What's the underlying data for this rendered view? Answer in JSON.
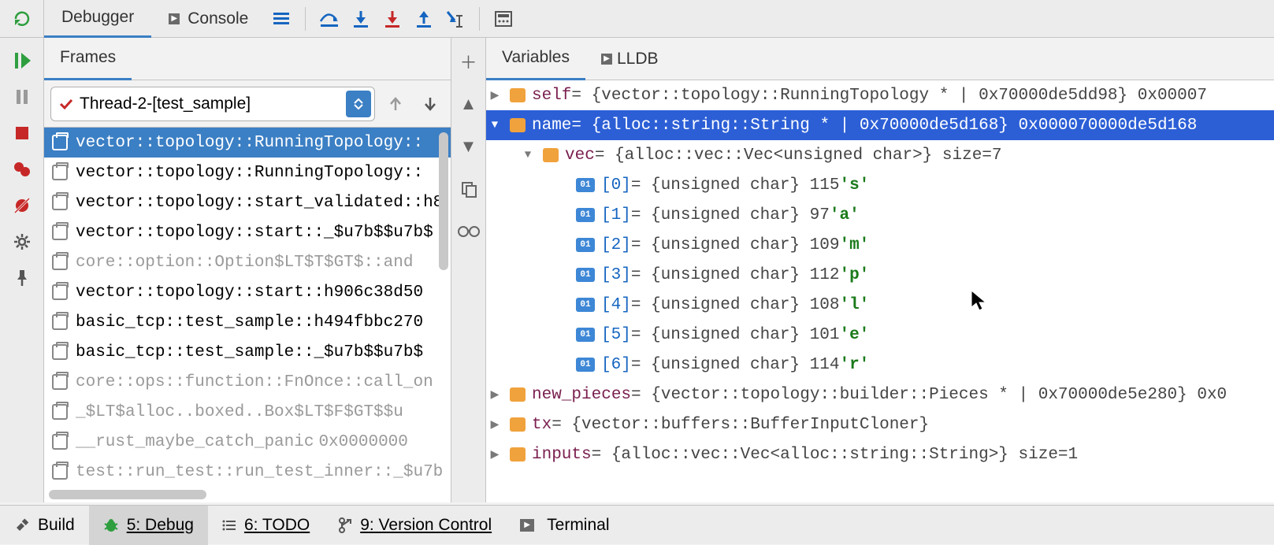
{
  "toolbar": {
    "tabs": {
      "debugger": "Debugger",
      "console": "Console"
    }
  },
  "frames": {
    "panel_label": "Frames",
    "thread": "Thread-2-[test_sample]",
    "items": [
      {
        "label": "vector::topology::RunningTopology::",
        "dim": false,
        "selected": true
      },
      {
        "label": "vector::topology::RunningTopology::",
        "dim": false
      },
      {
        "label": "vector::topology::start_validated::h8",
        "dim": false
      },
      {
        "label": "vector::topology::start::_$u7b$$u7b$",
        "dim": false
      },
      {
        "label": "core::option::Option$LT$T$GT$::and",
        "dim": true
      },
      {
        "label": "vector::topology::start::h906c38d50",
        "dim": false
      },
      {
        "label": "basic_tcp::test_sample::h494fbbc270",
        "dim": false
      },
      {
        "label": "basic_tcp::test_sample::_$u7b$$u7b$",
        "dim": false
      },
      {
        "label": "core::ops::function::FnOnce::call_on",
        "dim": true
      },
      {
        "label": "_$LT$alloc..boxed..Box$LT$F$GT$$u",
        "dim": true
      },
      {
        "label": "__rust_maybe_catch_panic",
        "dim": true,
        "hex": "0x0000000"
      },
      {
        "label": "test::run_test::run_test_inner::_$u7b",
        "dim": true
      }
    ]
  },
  "vars": {
    "tabs": {
      "variables": "Variables",
      "lldb": "LLDB"
    },
    "rows": [
      {
        "indent": 0,
        "twisty": "right",
        "kind": "struct",
        "name": "self",
        "value": " = {vector::topology::RunningTopology * | 0x70000de5dd98} 0x00007"
      },
      {
        "indent": 0,
        "twisty": "down",
        "kind": "struct",
        "name": "name",
        "value": " = {alloc::string::String * | 0x70000de5d168} 0x000070000de5d168",
        "selected": true
      },
      {
        "indent": 1,
        "twisty": "down",
        "kind": "struct",
        "name": "vec",
        "value": " = {alloc::vec::Vec<unsigned char>} size=7"
      },
      {
        "indent": 2,
        "twisty": "",
        "kind": "prim",
        "idx": "[0]",
        "value": " = {unsigned char} 115 ",
        "char": "'s'"
      },
      {
        "indent": 2,
        "twisty": "",
        "kind": "prim",
        "idx": "[1]",
        "value": " = {unsigned char} 97 ",
        "char": "'a'"
      },
      {
        "indent": 2,
        "twisty": "",
        "kind": "prim",
        "idx": "[2]",
        "value": " = {unsigned char} 109 ",
        "char": "'m'"
      },
      {
        "indent": 2,
        "twisty": "",
        "kind": "prim",
        "idx": "[3]",
        "value": " = {unsigned char} 112 ",
        "char": "'p'"
      },
      {
        "indent": 2,
        "twisty": "",
        "kind": "prim",
        "idx": "[4]",
        "value": " = {unsigned char} 108 ",
        "char": "'l'"
      },
      {
        "indent": 2,
        "twisty": "",
        "kind": "prim",
        "idx": "[5]",
        "value": " = {unsigned char} 101 ",
        "char": "'e'"
      },
      {
        "indent": 2,
        "twisty": "",
        "kind": "prim",
        "idx": "[6]",
        "value": " = {unsigned char} 114 ",
        "char": "'r'"
      },
      {
        "indent": 0,
        "twisty": "right",
        "kind": "struct",
        "name": "new_pieces",
        "value": " = {vector::topology::builder::Pieces * | 0x70000de5e280} 0x0"
      },
      {
        "indent": 0,
        "twisty": "right",
        "kind": "struct",
        "name": "tx",
        "value": " = {vector::buffers::BufferInputCloner}"
      },
      {
        "indent": 0,
        "twisty": "right",
        "kind": "struct",
        "name": "inputs",
        "value": " = {alloc::vec::Vec<alloc::string::String>} size=1"
      }
    ]
  },
  "bottombar": {
    "build": "Build",
    "debug": "5: Debug",
    "todo": "6: TODO",
    "vcs": "9: Version Control",
    "terminal": "Terminal"
  }
}
